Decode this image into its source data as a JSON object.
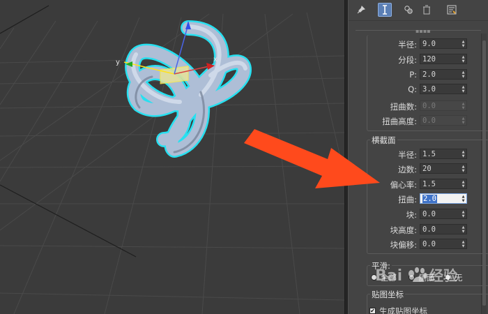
{
  "viewport": {
    "axis_x": "x",
    "axis_y": "y",
    "arrow_color": "#ff4a1c",
    "object_color": "#b7c6dc",
    "selection_color": "#27e0f0"
  },
  "toolbar": {
    "icons": [
      "pin-icon",
      "configure-modifiers-icon",
      "show-end-result-icon",
      "remove-modifier-icon",
      "modifier-sets-icon"
    ]
  },
  "base_curve": {
    "radius_label": "半径:",
    "radius_value": "9.0",
    "segments_label": "分段:",
    "segments_value": "120",
    "p_label": "P:",
    "p_value": "2.0",
    "q_label": "Q:",
    "q_value": "3.0",
    "warp_count_label": "扭曲数:",
    "warp_count_value": "0.0",
    "warp_height_label": "扭曲高度:",
    "warp_height_value": "0.0"
  },
  "cross_section": {
    "title": "横截面",
    "radius_label": "半径:",
    "radius_value": "1.5",
    "sides_label": "边数:",
    "sides_value": "20",
    "eccentricity_label": "偏心率:",
    "eccentricity_value": "1.5",
    "twist_label": "扭曲:",
    "twist_value": "2.0",
    "lumps_label": "块:",
    "lumps_value": "0.0",
    "lump_height_label": "块高度:",
    "lump_height_value": "0.0",
    "lump_offset_label": "块偏移:",
    "lump_offset_value": "0.0"
  },
  "smooth": {
    "title": "平滑:",
    "option_all": "全部",
    "option_sides": "侧面",
    "option_none": "无"
  },
  "mapping": {
    "title": "贴图坐标",
    "generate_label": "生成贴图坐标"
  },
  "watermark": {
    "text": "Bai",
    "text2": "经验"
  }
}
